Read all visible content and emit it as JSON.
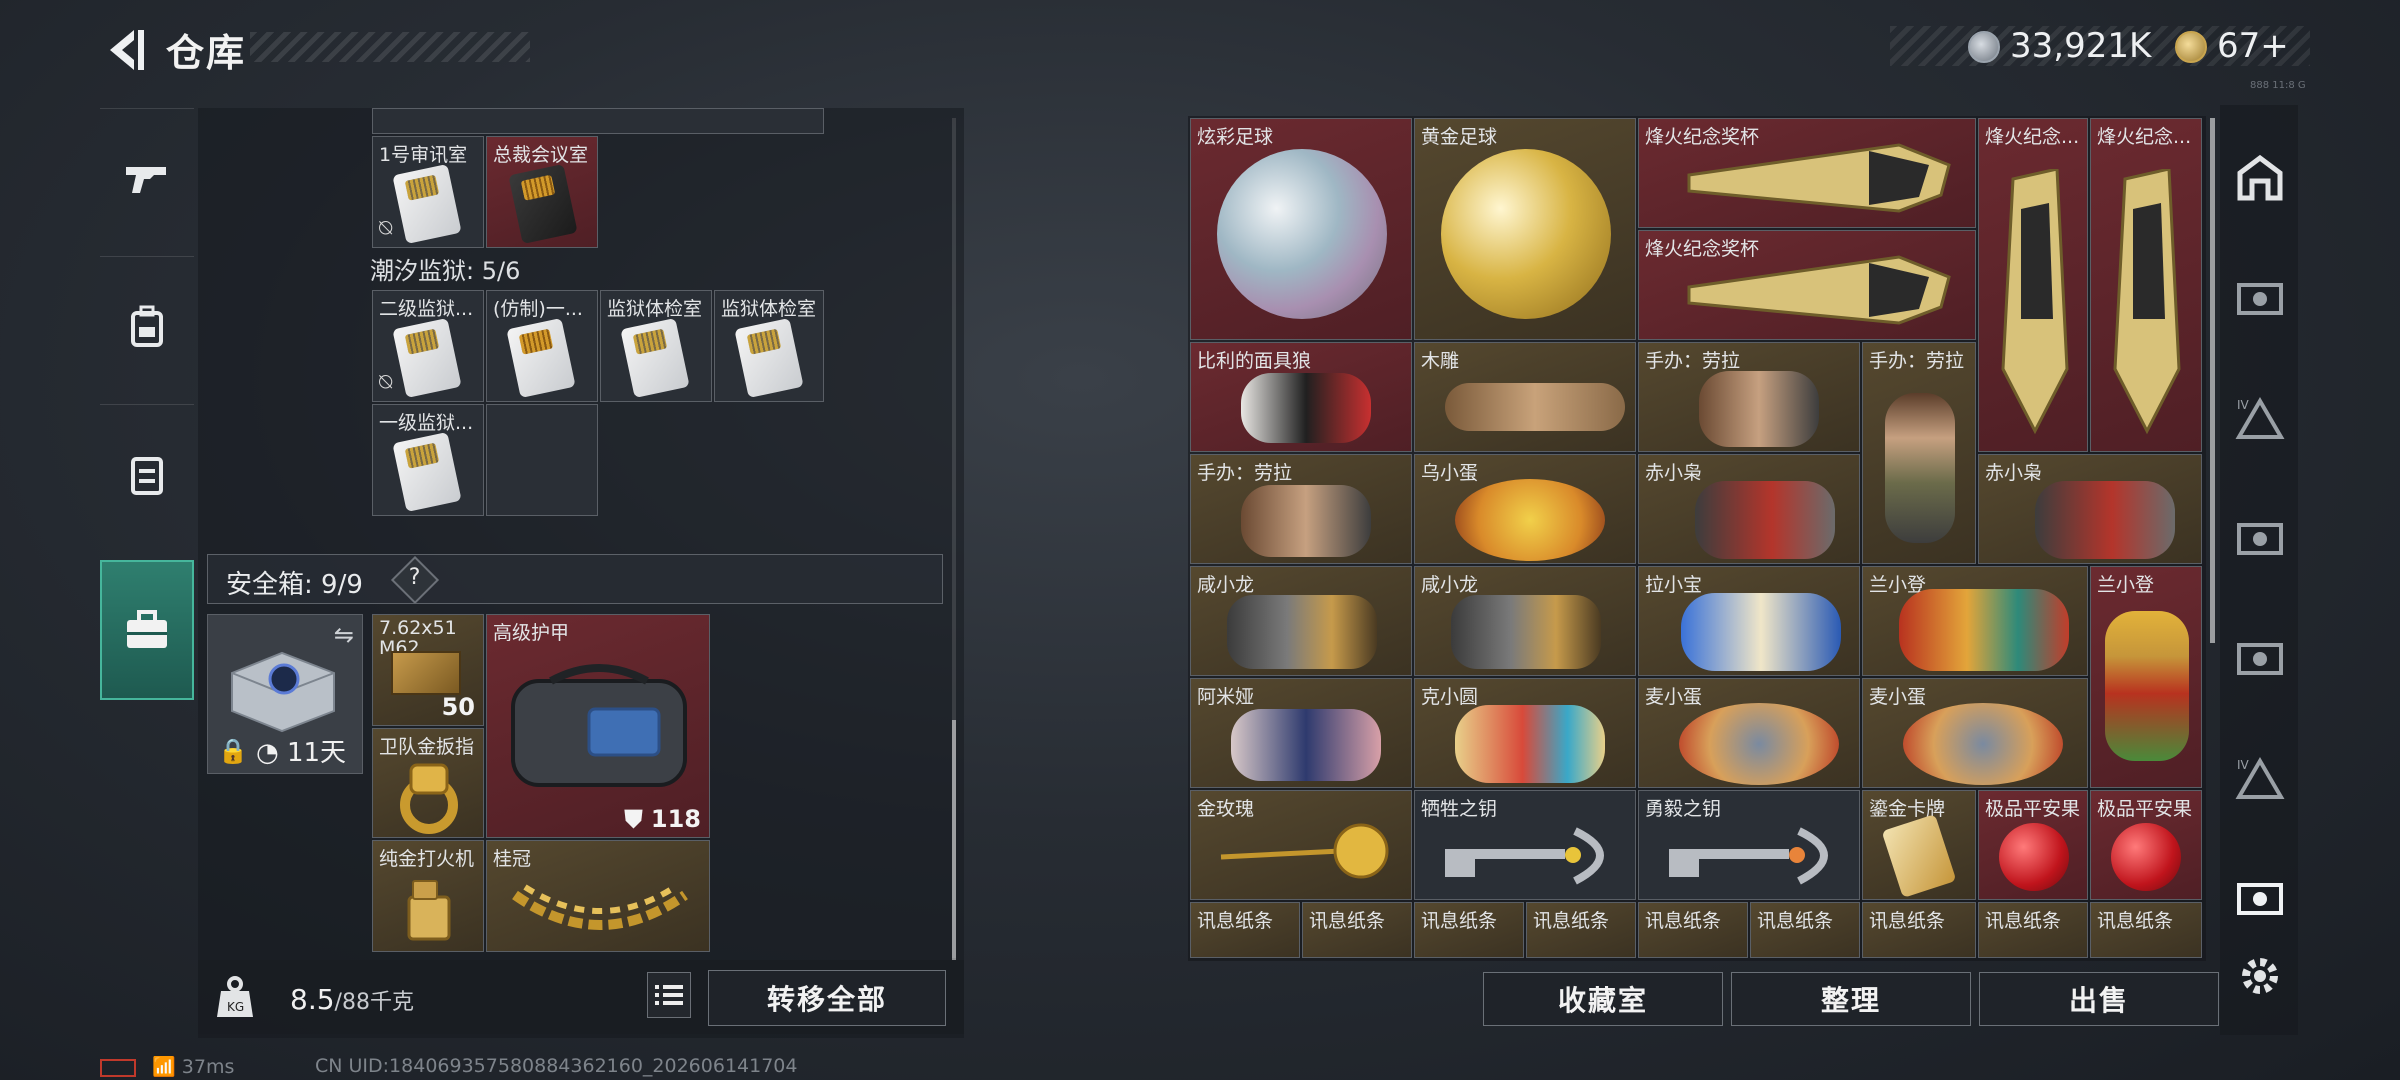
{
  "header": {
    "title": "仓库",
    "currency1": "33,921K",
    "currency2": "67+",
    "tiny_text": "888 11:8 G"
  },
  "nav": {
    "items": [
      "weapon",
      "backpack",
      "vest",
      "safe-box"
    ]
  },
  "left": {
    "row0": [
      {
        "label": "1号审讯室",
        "type": "card"
      },
      {
        "label": "总裁会议室",
        "type": "card-gold"
      }
    ],
    "section_title": "潮汐监狱: 5/6",
    "row1": [
      {
        "label": "二级监狱..."
      },
      {
        "label": "(仿制)一..."
      },
      {
        "label": "监狱体检室"
      },
      {
        "label": "监狱体检室"
      }
    ],
    "row2": [
      {
        "label": "一级监狱..."
      }
    ],
    "safebox_label": "安全箱: 9/9",
    "safebox_help": "?",
    "safebox_timer": "11天",
    "items": {
      "ammo_label": "7.62x51 M62",
      "ammo_count": "50",
      "armor_label": "高级护甲",
      "armor_durability": "118",
      "ring_label": "卫队金扳指",
      "lighter_label": "纯金打火机",
      "laurel_label": "桂冠"
    },
    "weight_value": "8.5",
    "weight_max": "/88千克",
    "transfer_all": "转移全部"
  },
  "status": {
    "ping": "37ms",
    "uid": "CN UID:184069357580884362160_202606141704"
  },
  "right": {
    "row0": [
      "炫彩足球",
      "黄金足球",
      "烽火纪念奖杯",
      "烽火纪念...",
      "烽火纪念..."
    ],
    "trophy2": "烽火纪念奖杯",
    "row1": [
      "比利的面具狼",
      "木雕",
      "手办：劳拉",
      "手办：劳拉"
    ],
    "row2": [
      "手办：劳拉",
      "乌小蛋",
      "赤小枭",
      "赤小枭"
    ],
    "row3": [
      "咸小龙",
      "咸小龙",
      "拉小宝",
      "兰小登",
      "兰小登"
    ],
    "row4": [
      "阿米娅",
      "克小圆",
      "麦小蛋",
      "麦小蛋"
    ],
    "row5": [
      "金玫瑰",
      "牺牲之钥",
      "勇毅之钥",
      "鎏金卡牌",
      "极品平安果",
      "极品平安果"
    ],
    "row6": [
      "讯息纸条",
      "讯息纸条",
      "讯息纸条",
      "讯息纸条",
      "讯息纸条",
      "讯息纸条",
      "讯息纸条",
      "讯息纸条",
      "讯息纸条"
    ],
    "collection_room": "收藏室",
    "sort": "整理",
    "sell": "出售"
  },
  "colors": {
    "accent": "#46b69c",
    "cell_red": "#5e252b",
    "cell_gold": "#4a3f2a"
  }
}
